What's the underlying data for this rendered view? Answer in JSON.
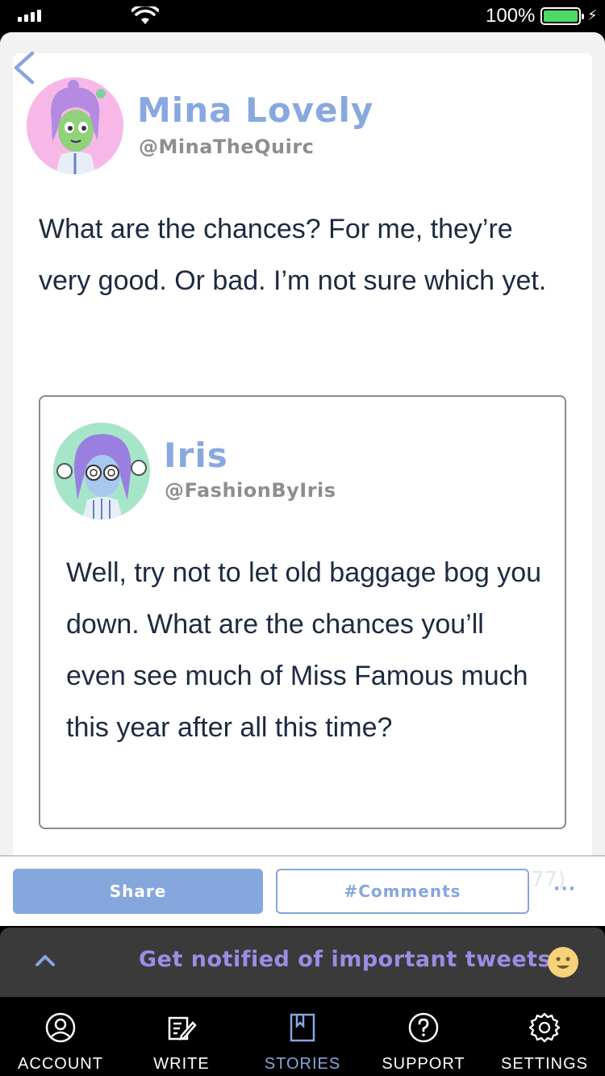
{
  "status": {
    "battery_percent": "100%",
    "battery_level": 1.0
  },
  "post": {
    "author_name": "Mina Lovely",
    "author_handle": "@MinaTheQuirc",
    "text": "What are the chances? For me, they’re very good. Or bad. I’m not sure which yet.",
    "quote": {
      "author_name": "Iris",
      "author_handle": "@FashionByIris",
      "text": "Well, try not to let old baggage bog you down. What are the chances you’ll even see much of Miss Famous much this year after all this time?"
    }
  },
  "actions": {
    "share_label": "Share",
    "comments_label": "#Comments",
    "more_label": "···",
    "ghost_text": "77)"
  },
  "notification": {
    "text": "Get notified of important tweets"
  },
  "tabs": [
    {
      "label": "ACCOUNT",
      "icon": "account-icon",
      "active": false
    },
    {
      "label": "WRITE",
      "icon": "write-icon",
      "active": false
    },
    {
      "label": "STORIES",
      "icon": "stories-icon",
      "active": true
    },
    {
      "label": "SUPPORT",
      "icon": "support-icon",
      "active": false
    },
    {
      "label": "SETTINGS",
      "icon": "settings-icon",
      "active": false
    }
  ],
  "colors": {
    "accent": "#86a6de",
    "name": "#88a8e0",
    "notif_text": "#9b8de4",
    "body_text": "#1c2a40"
  }
}
